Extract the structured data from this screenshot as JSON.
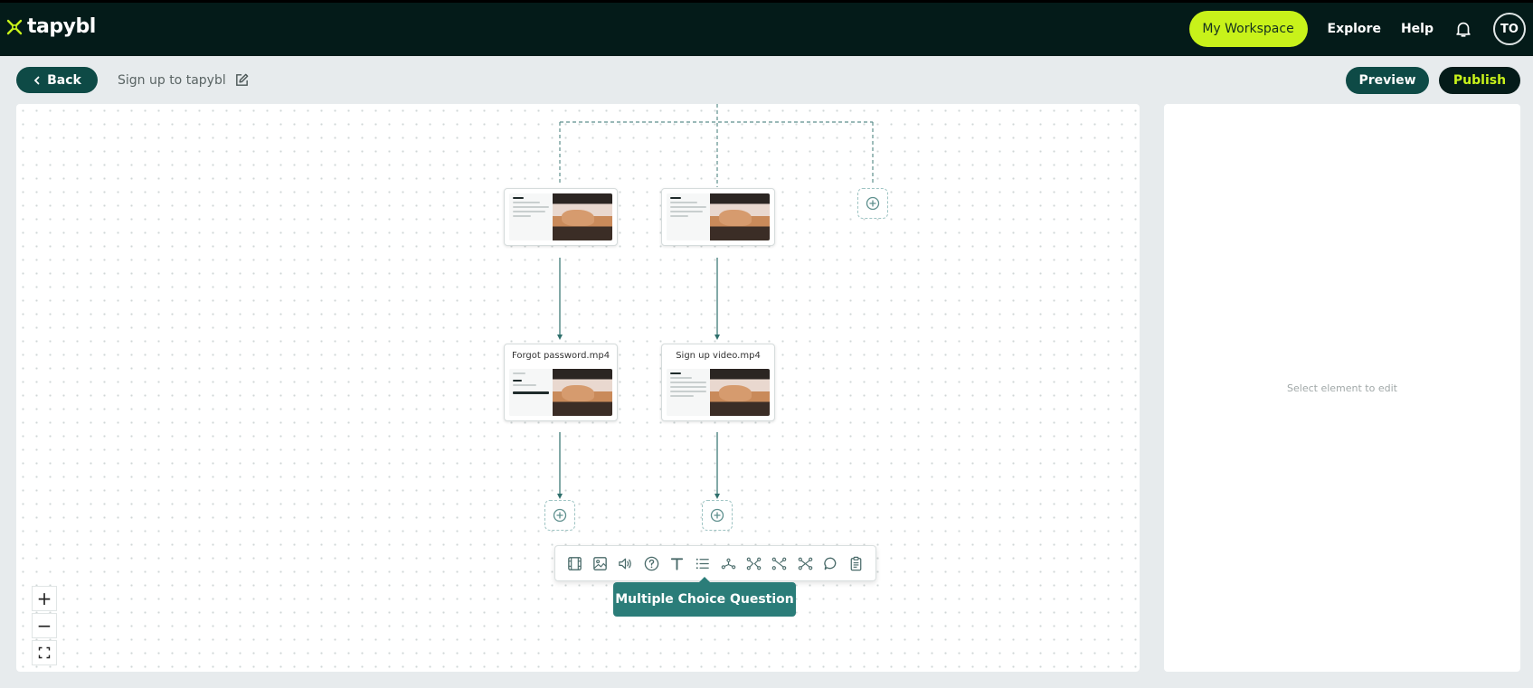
{
  "app": {
    "brand": "tapybl",
    "workspace_label": "My Workspace",
    "explore_label": "Explore",
    "help_label": "Help",
    "avatar_initials": "TO",
    "colors": {
      "topbar": "#041b19",
      "accent": "#c8f21a",
      "teal": "#0e4a46",
      "tooltip": "#2b7d79"
    }
  },
  "subheader": {
    "back_label": "Back",
    "flow_title": "Sign up to tapybl",
    "preview_label": "Preview",
    "publish_label": "Publish"
  },
  "canvas": {
    "nodes": [
      {
        "title": ""
      },
      {
        "title": ""
      },
      {
        "title": "Forgot password.mp4"
      },
      {
        "title": "Sign up video.mp4"
      }
    ],
    "toolbar_tools": [
      "video-icon",
      "image-icon",
      "audio-icon",
      "question-icon",
      "text-icon",
      "list-icon",
      "branch-icon",
      "connect-icon",
      "connect-alt-icon",
      "connect-cross-icon",
      "comment-icon",
      "clipboard-icon"
    ],
    "tooltip": "Multiple Choice Question",
    "zoom_in": "+",
    "zoom_out": "−"
  },
  "panel": {
    "empty_text": "Select element to edit"
  }
}
